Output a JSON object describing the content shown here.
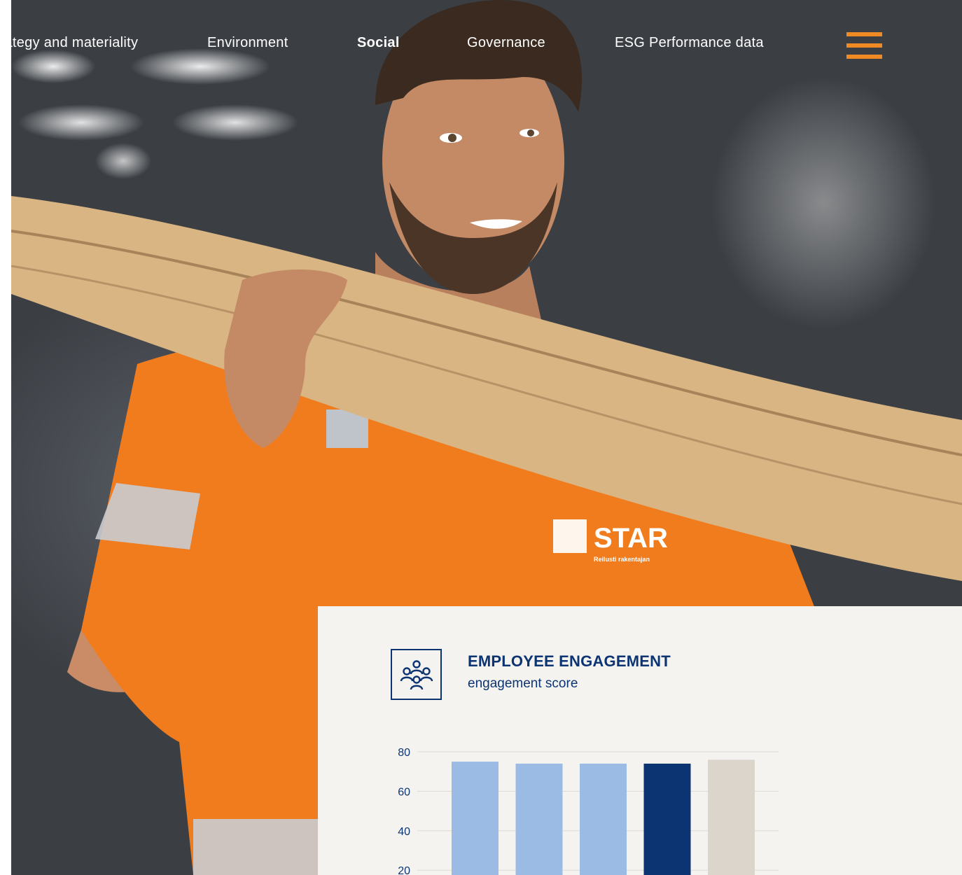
{
  "nav": {
    "items": [
      {
        "label": "Strategy and materiality",
        "active": false
      },
      {
        "label": "Environment",
        "active": false
      },
      {
        "label": "Social",
        "active": true
      },
      {
        "label": "Governance",
        "active": false
      },
      {
        "label": "ESG Performance data",
        "active": false
      }
    ],
    "menu_icon": "hamburger-icon",
    "menu_color": "#f08a24"
  },
  "hero": {
    "shirt_logo_text": "STAR",
    "shirt_tagline": "Reilusti rakentajan"
  },
  "card": {
    "icon": "people-group-icon",
    "title": "EMPLOYEE ENGAGEMENT",
    "subtitle": "engagement score"
  },
  "chart_data": {
    "type": "bar",
    "title": "EMPLOYEE ENGAGEMENT",
    "subtitle": "engagement score",
    "categories": [
      "",
      "",
      "",
      "",
      ""
    ],
    "values": [
      75,
      74,
      74,
      74,
      76
    ],
    "colors": [
      "#9bbbe4",
      "#9bbbe4",
      "#9bbbe4",
      "#0c3473",
      "#dcd5cc"
    ],
    "yticks": [
      20,
      40,
      60,
      80
    ],
    "ylim": [
      0,
      80
    ],
    "grid": true
  }
}
